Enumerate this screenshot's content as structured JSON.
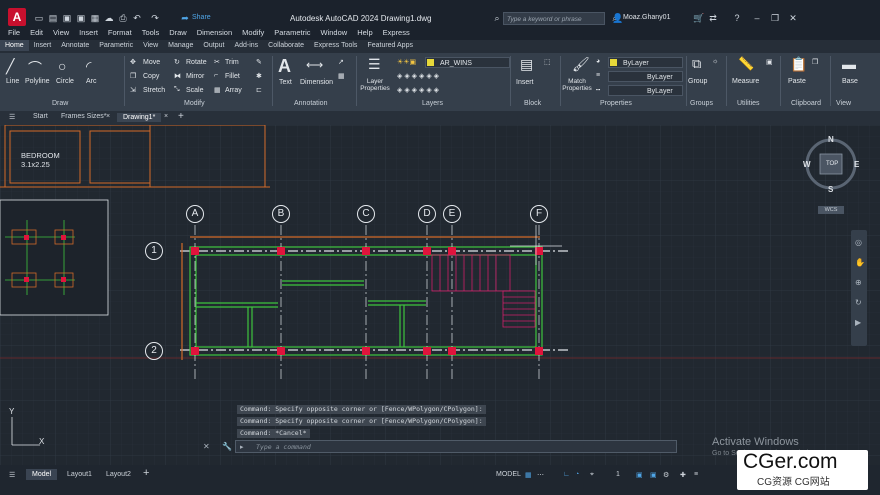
{
  "app": {
    "logo": "A",
    "title": "Autodesk AutoCAD 2024    Drawing1.dwg",
    "share": "Share",
    "search_placeholder": "Type a keyword or phrase",
    "user": "Moaz.Ghany01"
  },
  "menu": [
    "File",
    "Edit",
    "View",
    "Insert",
    "Format",
    "Tools",
    "Draw",
    "Dimension",
    "Modify",
    "Parametric",
    "Window",
    "Help",
    "Express"
  ],
  "ribbon_tabs": [
    "Home",
    "Insert",
    "Annotate",
    "Parametric",
    "View",
    "Manage",
    "Output",
    "Add-ins",
    "Collaborate",
    "Express Tools",
    "Featured Apps"
  ],
  "draw": {
    "line": "Line",
    "polyline": "Polyline",
    "circle": "Circle",
    "arc": "Arc",
    "title": "Draw"
  },
  "modify": {
    "move": "Move",
    "rotate": "Rotate",
    "trim": "Trim",
    "copy": "Copy",
    "mirror": "Mirror",
    "fillet": "Fillet",
    "stretch": "Stretch",
    "scale": "Scale",
    "array": "Array",
    "title": "Modify"
  },
  "annotation": {
    "text": "Text",
    "dimension": "Dimension",
    "title": "Annotation"
  },
  "layers": {
    "layer_properties": "Layer Properties",
    "current_layer": "AR_WINS",
    "title": "Layers"
  },
  "block": {
    "insert": "Insert",
    "title": "Block"
  },
  "properties": {
    "match": "Match Properties",
    "bylayer1": "ByLayer",
    "bylayer2": "ByLayer",
    "bylayer3": "ByLayer",
    "title": "Properties"
  },
  "groups": {
    "group": "Group",
    "title": "Groups"
  },
  "utilities": {
    "measure": "Measure",
    "title": "Utilities"
  },
  "clipboard": {
    "paste": "Paste",
    "title": "Clipboard"
  },
  "base": {
    "label": "Base",
    "view_title": "View"
  },
  "file_tabs": {
    "start": "Start",
    "frames": "Frames Sizes*",
    "drawing": "Drawing1*"
  },
  "drawing": {
    "room_name": "BEDROOM",
    "room_size": "3.1x2.25",
    "grid_cols": [
      "A",
      "B",
      "C",
      "D",
      "E",
      "F"
    ],
    "grid_rows": [
      "1",
      "2"
    ]
  },
  "viewcube": {
    "n": "N",
    "s": "S",
    "e": "E",
    "w": "W",
    "top": "TOP",
    "wcs": "WCS"
  },
  "command": {
    "line1": "Command: Specify opposite corner or [Fence/WPolygon/CPolygon]:",
    "line2": "Command: Specify opposite corner or [Fence/WPolygon/CPolygon]:",
    "line3": "Command: *Cancel*",
    "placeholder": "Type a command"
  },
  "watermark": {
    "line1": "Activate Windows",
    "line2": "Go to Settings to activate Windows."
  },
  "status": {
    "model": "Model",
    "layout1": "Layout1",
    "layout2": "Layout2",
    "model_space": "MODEL",
    "scale": "1"
  },
  "brand": {
    "big": "CGer.com",
    "small": "CG资源 CG网站"
  },
  "colors": {
    "accent": "#c8102e",
    "beam": "#3ec43e",
    "column": "#e0143c",
    "hatch": "#d0206a",
    "orange": "#d26a28"
  }
}
